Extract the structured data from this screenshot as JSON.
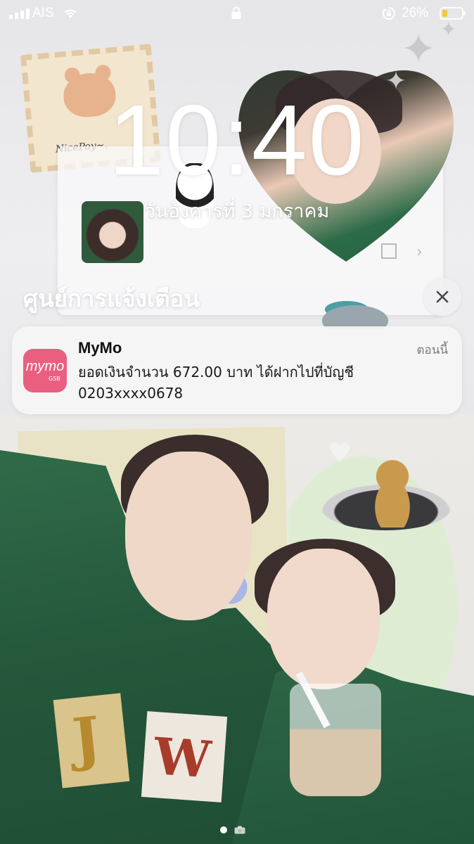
{
  "status_bar": {
    "carrier": "AIS",
    "battery_percent": "26%",
    "battery_level": 0.26,
    "battery_color": "#f5c739",
    "icons": [
      "signal-icon",
      "wifi-icon",
      "lock-icon",
      "rotation-lock-icon",
      "battery-icon"
    ]
  },
  "lock_screen": {
    "time": "10:40",
    "date": "วันอังคารที่ 3 มกราคม"
  },
  "notification_center": {
    "title": "ศูนย์การแจ้งเตือน",
    "clear_icon": "close-icon"
  },
  "notification": {
    "app_name": "MyMo",
    "app_icon_text": "mymo",
    "app_icon_subtext": "GSB",
    "app_icon_color": "#ea5f80",
    "time": "ตอนนี้",
    "body_line1": "ยอดเงินจำนวน 672.00 บาท ได้ฝากไปที่บัญชี",
    "body_line2": "0203xxxx0678"
  },
  "wallpaper": {
    "stamp_text": "NicePoy~.",
    "patch_letter_1": "J",
    "patch_letter_2": "W"
  },
  "page_indicator": {
    "pages": 2,
    "current": 1
  }
}
